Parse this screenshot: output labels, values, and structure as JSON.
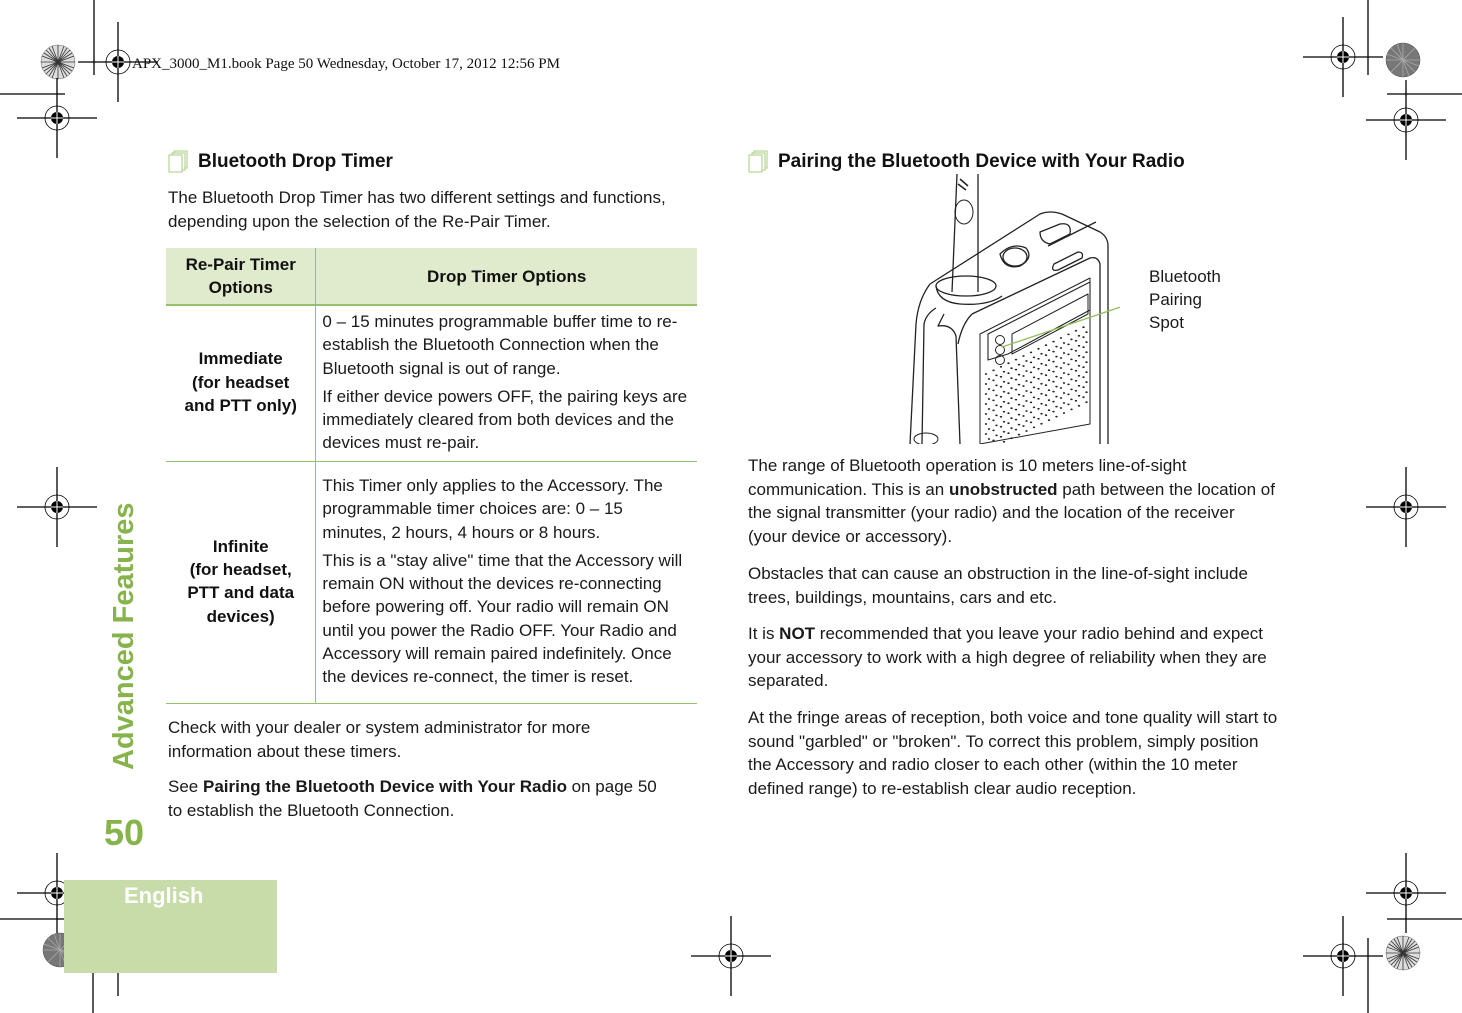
{
  "print_header": "APX_3000_M1.book  Page 50  Wednesday, October 17, 2012  12:56 PM",
  "side": {
    "section_title": "Advanced Features",
    "page_number": "50",
    "language_tab": "English"
  },
  "colors": {
    "accent_green": "#86b34a",
    "table_header_bg": "#dfebcc",
    "table_rule": "#97c06a",
    "language_tab_bg": "#c7dca8",
    "callout_line": "#8fbf5a"
  },
  "left_column": {
    "heading": "Bluetooth Drop Timer",
    "intro": "The Bluetooth Drop Timer has two different settings and functions, depending upon the selection of the Re-Pair Timer.",
    "table": {
      "headers": [
        "Re-Pair Timer Options",
        "Drop Timer Options"
      ],
      "rows": [
        {
          "option": "Immediate (for headset and PTT only)",
          "option_lines": [
            "Immediate",
            "(for headset",
            "and PTT only)"
          ],
          "paragraphs": [
            "0 – 15 minutes programmable buffer time to re-establish the Bluetooth Connection when the Bluetooth signal is out of range.",
            "If either device powers OFF, the pairing keys are immediately cleared from both devices and the devices must re-pair."
          ]
        },
        {
          "option": "Infinite (for headset, PTT and data devices)",
          "option_lines": [
            "Infinite",
            "(for headset,",
            "PTT and data",
            "devices)"
          ],
          "paragraphs": [
            "This Timer only applies to the Accessory. The programmable timer choices are: 0 – 15 minutes, 2 hours, 4 hours or 8 hours.",
            "This is a \"stay alive\" time that the Accessory will remain ON without the devices re-connecting before powering off. Your radio will remain ON until you power the Radio OFF. Your Radio and Accessory will remain paired indefinitely. Once the devices re-connect, the timer is reset."
          ]
        }
      ]
    },
    "after_table": "Check with your dealer or system administrator for more information about these timers.",
    "see_also": {
      "prefix": "See ",
      "link": "Pairing the Bluetooth Device with Your Radio",
      "suffix": " on page 50 to establish the Bluetooth Connection."
    }
  },
  "right_column": {
    "heading": "Pairing the Bluetooth Device with Your Radio",
    "figure": {
      "subject": "radio-illustration",
      "callout_lines": [
        "Bluetooth",
        "Pairing",
        "Spot"
      ]
    },
    "p1": {
      "before": "The range of Bluetooth operation is 10 meters line-of-sight communication. This is an ",
      "bold": "unobstructed",
      "after": " path between the location of the signal transmitter (your radio) and the location of the receiver (your device or accessory)."
    },
    "p2": "Obstacles that can cause an obstruction in the line-of-sight include trees, buildings, mountains, cars and etc.",
    "p3": {
      "before": "It is ",
      "bold": "NOT",
      "after": " recommended that you leave your radio behind and expect your accessory to work with a high degree of reliability when they are separated."
    },
    "p4": "At the fringe areas of reception, both voice and tone quality will start to sound \"garbled\" or \"broken\". To correct this problem, simply position the Accessory and radio closer to each other (within the 10 meter defined range) to re-establish clear audio reception."
  }
}
